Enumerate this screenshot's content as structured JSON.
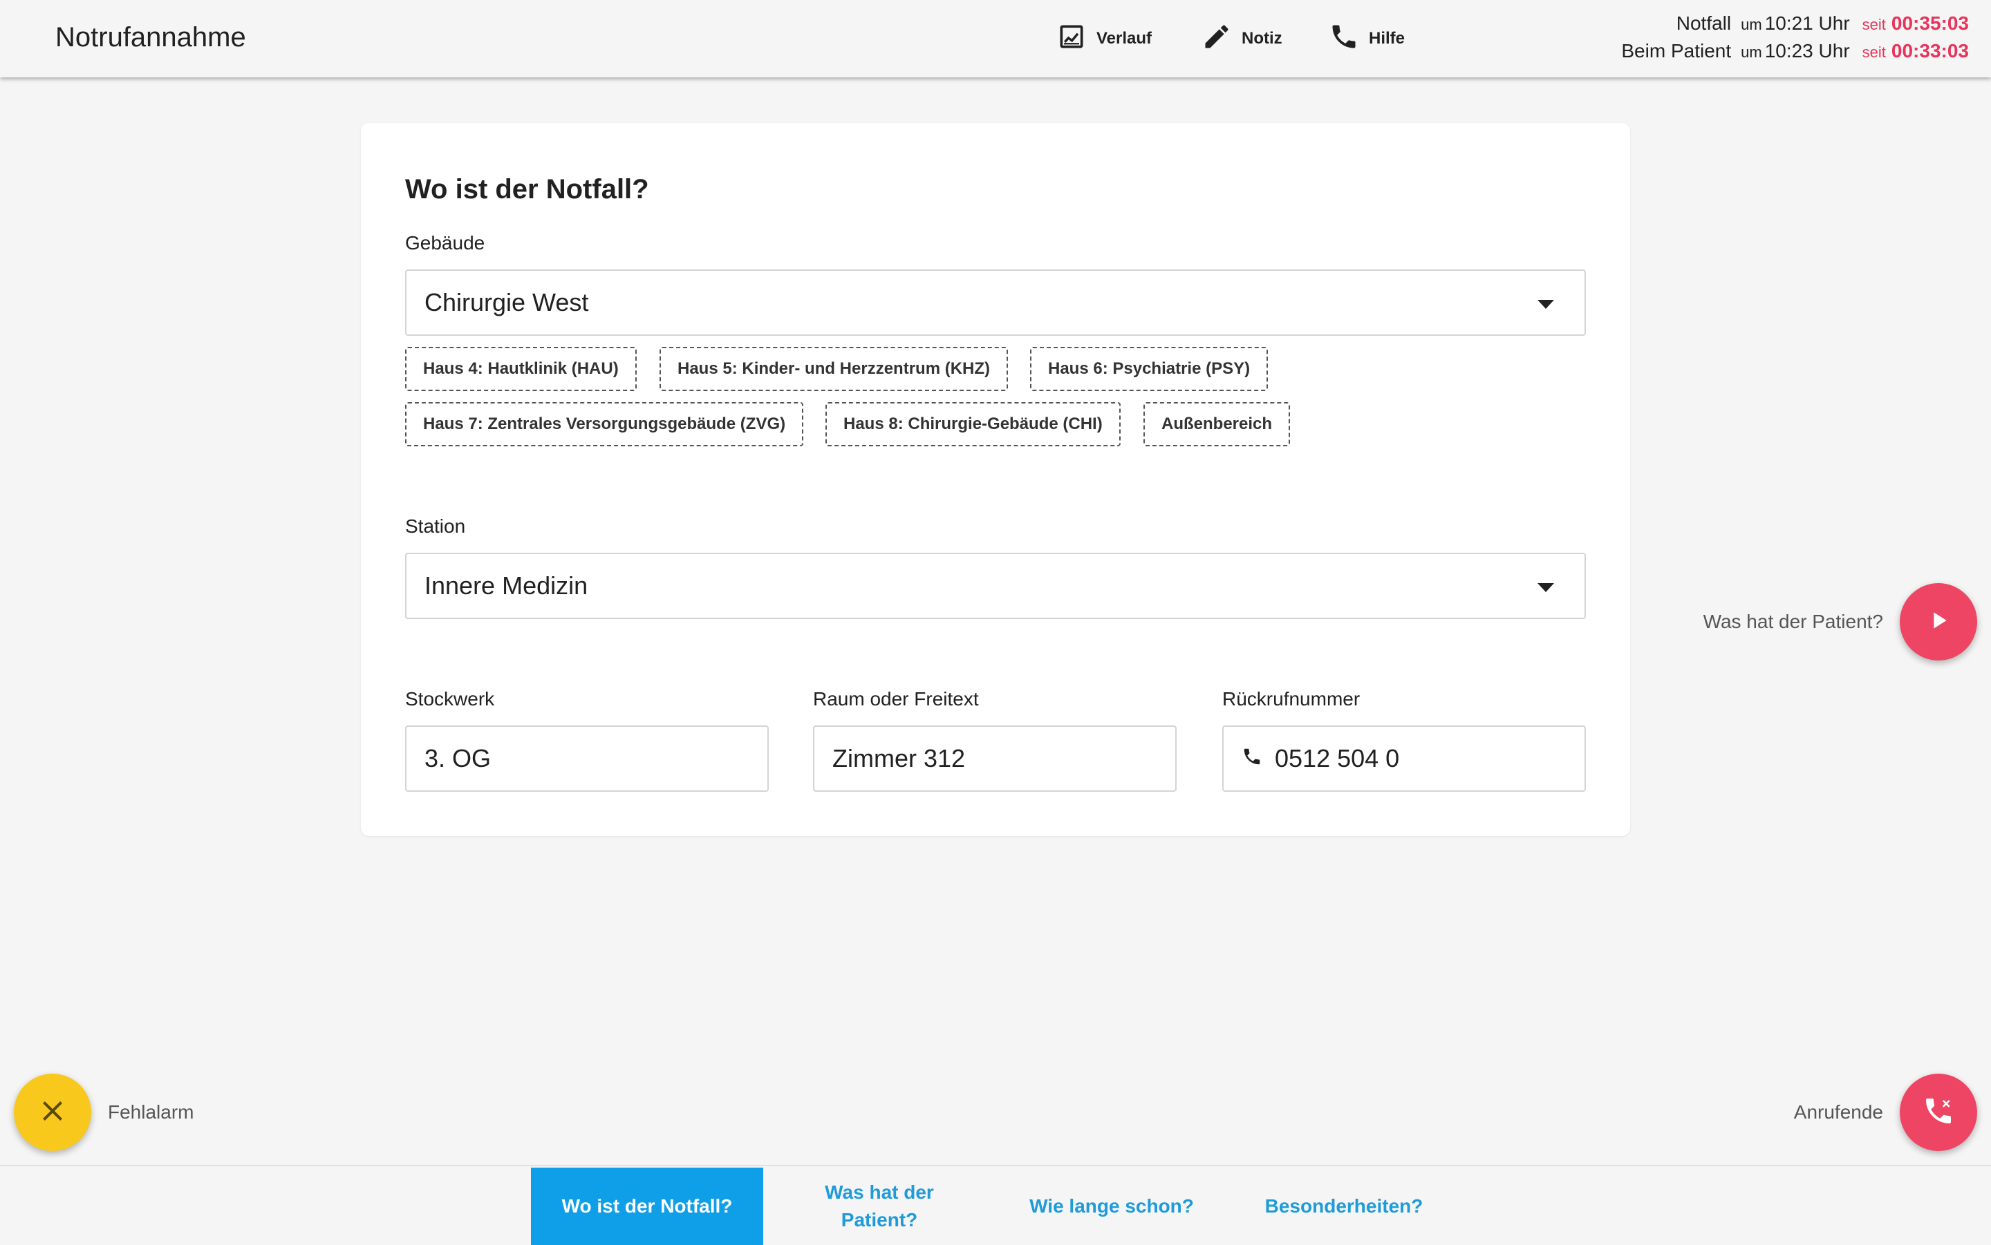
{
  "header": {
    "app_title": "Notrufannahme",
    "actions": [
      {
        "label": "Verlauf",
        "icon": "chart-icon"
      },
      {
        "label": "Notiz",
        "icon": "pencil-icon"
      },
      {
        "label": "Hilfe",
        "icon": "phone-icon"
      }
    ],
    "timers": [
      {
        "label": "Notfall",
        "um": "um",
        "time": "10:21 Uhr",
        "seit": "seit",
        "elapsed": "00:35:03"
      },
      {
        "label": "Beim Patient",
        "um": "um",
        "time": "10:23 Uhr",
        "seit": "seit",
        "elapsed": "00:33:03"
      }
    ]
  },
  "form": {
    "title": "Wo ist der Notfall?",
    "gebaeude": {
      "label": "Gebäude",
      "value": "Chirurgie West",
      "chips": [
        "Haus 4: Hautklinik (HAU)",
        "Haus 5: Kinder- und Herzzentrum (KHZ)",
        "Haus 6: Psychiatrie (PSY)",
        "Haus 7: Zentrales Versorgungsgebäude (ZVG)",
        "Haus 8: Chirurgie-Gebäude (CHI)",
        "Außenbereich"
      ]
    },
    "station": {
      "label": "Station",
      "value": "Innere Medizin"
    },
    "stockwerk": {
      "label": "Stockwerk",
      "value": "3. OG"
    },
    "raum": {
      "label": "Raum oder Freitext",
      "value": "Zimmer 312"
    },
    "rueckruf": {
      "label": "Rückrufnummer",
      "value": "0512 504 0"
    }
  },
  "side": {
    "next_label": "Was hat der Patient?",
    "fehlalarm_label": "Fehlalarm",
    "anrufende_label": "Anrufende"
  },
  "tabs": [
    {
      "label": "Wo ist der Notfall?",
      "active": true
    },
    {
      "label": "Was hat der Patient?",
      "active": false
    },
    {
      "label": "Wie lange schon?",
      "active": false
    },
    {
      "label": "Besonderheiten?",
      "active": false
    }
  ],
  "colors": {
    "accent_red": "#ef4564",
    "accent_yellow": "#f8c81c",
    "tab_blue": "#0f9ee8",
    "timer_red": "#e8345a"
  }
}
